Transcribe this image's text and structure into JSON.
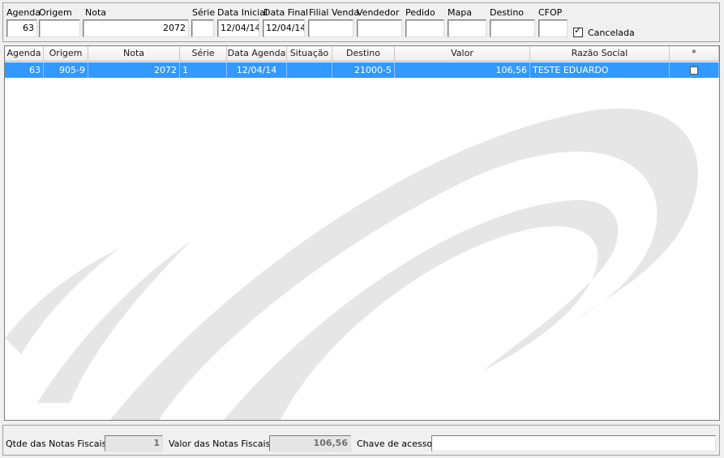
{
  "filters": {
    "agenda_label": "Agenda",
    "agenda_value": "63",
    "origem_label": "Origem",
    "origem_value": "",
    "nota_label": "Nota",
    "nota_value": "2072",
    "serie_label": "Série",
    "serie_value": "",
    "data_inicial_label": "Data Inicial",
    "data_inicial_value": "12/04/14",
    "data_final_label": "Data Final",
    "data_final_value": "12/04/14",
    "filial_venda_label": "Filial Venda",
    "filial_venda_value": "",
    "vendedor_label": "Vendedor",
    "vendedor_value": "",
    "pedido_label": "Pedido",
    "pedido_value": "",
    "mapa_label": "Mapa",
    "mapa_value": "",
    "destino_label": "Destino",
    "destino_value": "",
    "cfop_label": "CFOP",
    "cfop_value": "",
    "cancelada_label": "Cancelada",
    "cancelada_checked": true,
    "check_glyph": "✓"
  },
  "grid": {
    "columns": [
      "Agenda",
      "Origem",
      "Nota",
      "Série",
      "Data Agenda",
      "Situação",
      "Destino",
      "Valor",
      "Razão Social",
      "*"
    ],
    "rows": [
      {
        "agenda": "63",
        "origem": "905-9",
        "nota": "2072",
        "serie": "1",
        "data_agenda": "12/04/14",
        "situacao": "",
        "destino": "21000-5",
        "valor": "106,56",
        "razao_social": "TESTE EDUARDO",
        "selected_mark": false
      }
    ],
    "selection_color": "#3399ff"
  },
  "footer": {
    "qtde_label": "Qtde das Notas Fiscais:",
    "qtde_value": "1",
    "valor_label": "Valor  das Notas Fiscais:",
    "valor_value": "106,56",
    "chave_label": "Chave de acesso:",
    "chave_value": ""
  }
}
